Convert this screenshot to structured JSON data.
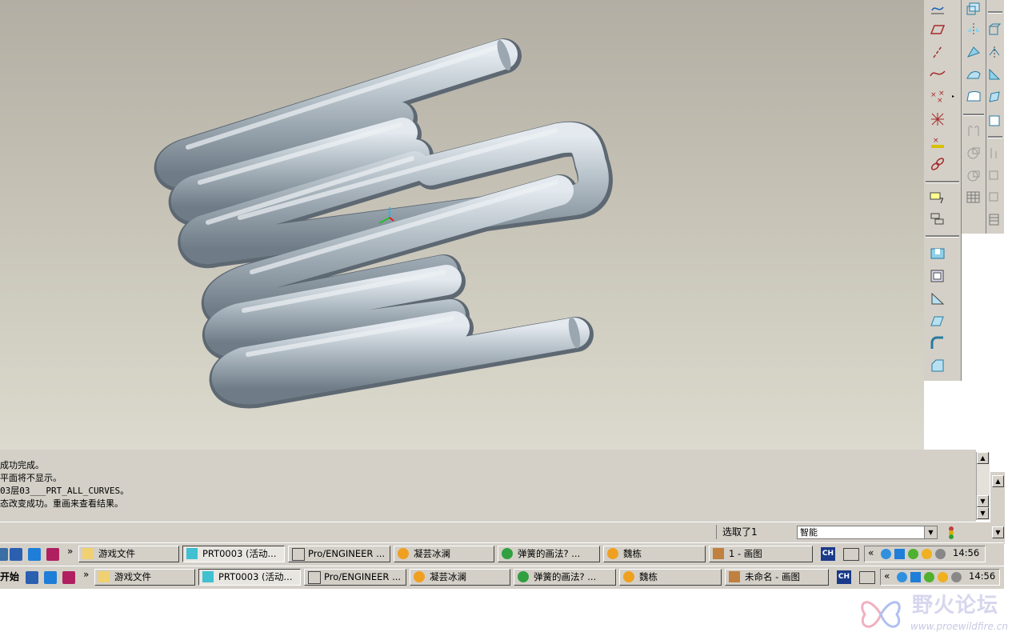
{
  "messages": [
    "成功完成。",
    "平面将不显示。",
    "03层03___PRT_ALL_CURVES。",
    "态改变成功。重画来查看结果。"
  ],
  "status": {
    "selected": "选取了1",
    "filter_value": "智能"
  },
  "taskbar1": {
    "items": [
      "游戏文件",
      "PRT0003 (活动...",
      "Pro/ENGINEER ...",
      "凝芸冰澜",
      "弹簧的画法? ...",
      "魏栋",
      "1 - 画图"
    ],
    "lang": "CH",
    "clock": "14:56"
  },
  "taskbar2": {
    "start": "开始",
    "items": [
      "游戏文件",
      "PRT0003 (活动...",
      "Pro/ENGINEER ...",
      "凝芸冰澜",
      "弹簧的画法? ...",
      "魏栋",
      "未命名 - 画图"
    ],
    "lang": "CH",
    "clock": "14:56"
  },
  "watermark": {
    "text": "野火论坛",
    "url": "www.proewildfire.cn"
  },
  "colors": {
    "spring": "#a9b4bd",
    "toolbar": "#d4d0c8",
    "console_bg": "#d4d0c8"
  }
}
